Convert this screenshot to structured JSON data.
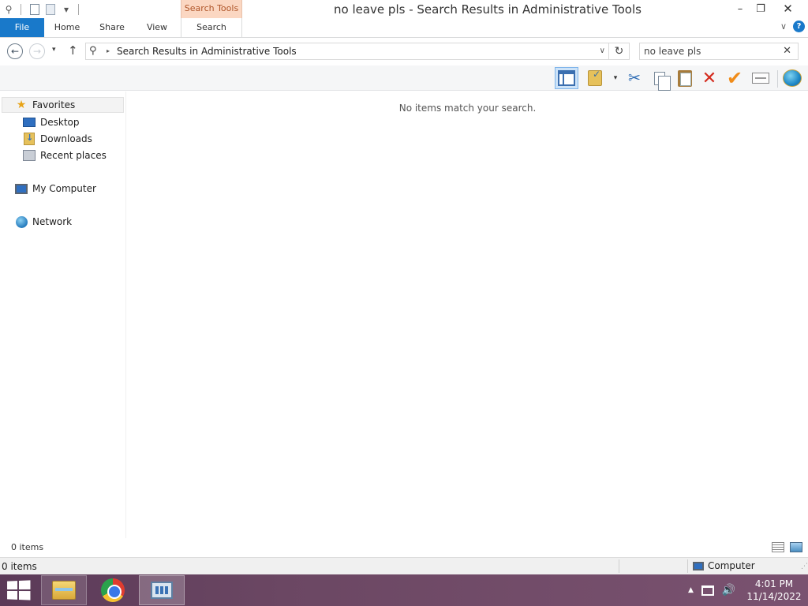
{
  "window": {
    "title": "no leave pls - Search Results in Administrative Tools",
    "minimize": "–",
    "restore": "❐",
    "close": "✕"
  },
  "qat": {
    "search_glyph": "⚲",
    "customize_glyph": "▾"
  },
  "ribbon": {
    "context_group": "Search Tools",
    "tabs": {
      "file": "File",
      "home": "Home",
      "share": "Share",
      "view": "View",
      "search": "Search"
    },
    "collapse_glyph": "∨",
    "help_glyph": "?"
  },
  "address_bar": {
    "back_glyph": "←",
    "forward_glyph": "→",
    "recent_glyph": "▾",
    "up_glyph": "↑",
    "search_glyph": "⚲",
    "crumb_separator": "▸",
    "path": "Search Results in Administrative Tools",
    "dropdown_glyph": "∨",
    "refresh_glyph": "↻"
  },
  "search_box": {
    "value": "no leave pls",
    "clear_glyph": "✕"
  },
  "toolbar": {
    "items": [
      "preview-pane",
      "properties",
      "cut",
      "copy",
      "paste",
      "delete",
      "check",
      "rename",
      "globe"
    ],
    "cut_glyph": "✂",
    "delete_glyph": "✕",
    "check_glyph": "✔",
    "dropdown_glyph": "▾"
  },
  "nav_pane": {
    "favorites": "Favorites",
    "star_glyph": "★",
    "desktop": "Desktop",
    "downloads": "Downloads",
    "recent_places": "Recent places",
    "my_computer": "My Computer",
    "network": "Network"
  },
  "content": {
    "empty_message": "No items match your search."
  },
  "status_bar": {
    "item_count": "0 items"
  },
  "status_bar_classic": {
    "item_count": "0 items",
    "zone": "Computer",
    "grip_glyph": "⋰"
  },
  "taskbar": {
    "apps": [
      "file-explorer",
      "chrome",
      "administrative-tools"
    ],
    "tray_up_glyph": "▲",
    "volume_glyph": "🔊",
    "time": "4:01 PM",
    "date": "11/14/2022"
  },
  "colors": {
    "accent": "#1979ca",
    "context_tab": "#fbd7c2",
    "taskbar": "#6b4763"
  }
}
